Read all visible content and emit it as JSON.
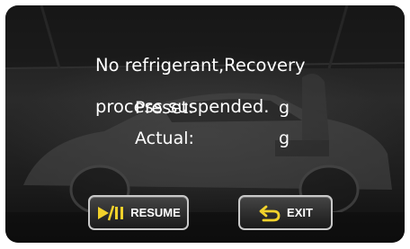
{
  "message": {
    "line1": "No refrigerant,Recovery",
    "line2": "process suspended."
  },
  "preset": {
    "label": "Preset:",
    "unit": "g"
  },
  "actual": {
    "label": "Actual:",
    "unit": "g"
  },
  "buttons": {
    "resume_label": "RESUME",
    "exit_label": "EXIT"
  },
  "icons": {
    "resume": "play-pause-icon",
    "exit": "return-arrow-icon"
  },
  "colors": {
    "accent_yellow": "#f2d22b",
    "text": "#ffffff"
  }
}
